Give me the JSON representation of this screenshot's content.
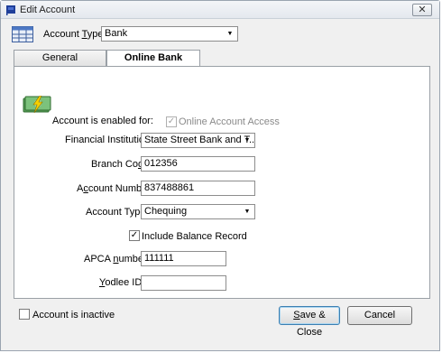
{
  "window": {
    "title": "Edit Account",
    "close_glyph": "✕"
  },
  "account_type": {
    "label_pre": "Account ",
    "label_key": "T",
    "label_post": "ype",
    "value": "Bank"
  },
  "tabs": [
    {
      "label": "General"
    },
    {
      "label": "Online Bank Details",
      "active": true
    }
  ],
  "online": {
    "enabled_label": "Account is enabled for:",
    "online_access_label": "Online Account Access",
    "online_access_checked": true,
    "fi_label": "Financial Institution:",
    "fi_value": "State Street Bank and T...",
    "branch_pre": "Branch Co",
    "branch_key": "d",
    "branch_post": "e:",
    "branch_value": "012356",
    "acct_num_pre": "A",
    "acct_num_key": "c",
    "acct_num_post": "count Number:",
    "acct_num_value": "837488861",
    "acct_type_label": "Account Type:",
    "acct_type_value": "Chequing",
    "include_balance_label": "Include Balance Record",
    "include_balance_checked": true,
    "apca_pre": "APCA ",
    "apca_key": "n",
    "apca_post": "umber:",
    "apca_value": "111111",
    "yodlee_pre": "",
    "yodlee_key": "Y",
    "yodlee_post": "odlee ID:",
    "yodlee_value": ""
  },
  "footer": {
    "inactive_label": "Account is inactive",
    "inactive_checked": false,
    "save_pre": "",
    "save_key": "S",
    "save_post": "ave & Close",
    "cancel_label": "Cancel"
  },
  "colors": {
    "accent": "#3c7fb1",
    "title_icon": "#1f3f9a"
  },
  "icons": {
    "title": "flag-icon",
    "account_type": "ledger-icon",
    "online_banking": "money-bolt-icon",
    "dropdown": "triangle-down-icon",
    "check": "check-mark"
  },
  "glyphs": {
    "dropdown": "▼",
    "check": "✓"
  }
}
